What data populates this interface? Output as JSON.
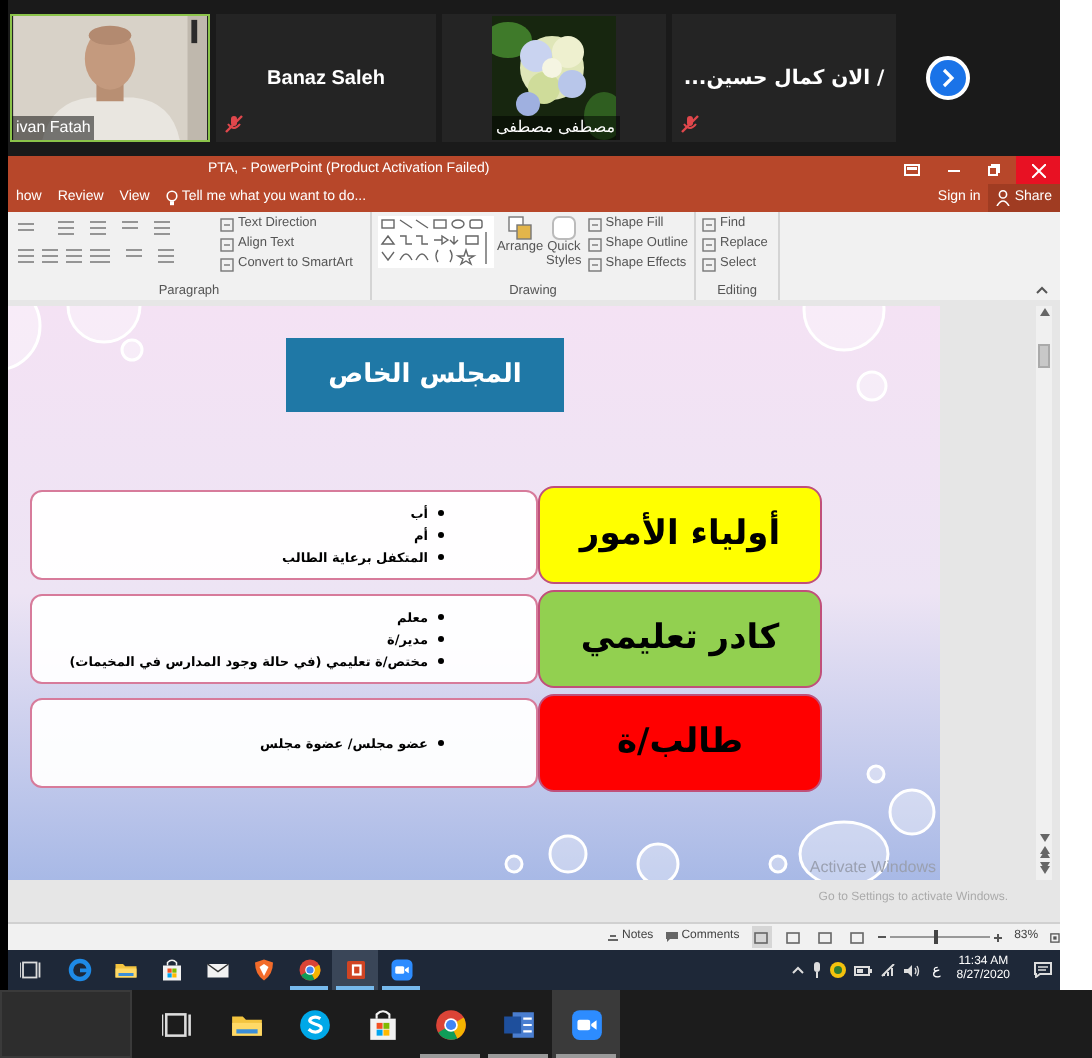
{
  "meeting": {
    "participants": [
      {
        "kind": "video",
        "name": "ivan Fatah",
        "speaking": true,
        "muted": false
      },
      {
        "kind": "name",
        "name": "Banaz Saleh",
        "speaking": false,
        "muted": true
      },
      {
        "name": "مصطفى مصطفى",
        "speaking": false,
        "muted": false
      },
      {
        "kind": "name",
        "name": "...الان كمال حسين /",
        "speaking": false,
        "muted": true
      }
    ]
  },
  "powerpoint": {
    "title": "PTA, - PowerPoint (Product Activation Failed)",
    "tabs": [
      {
        "label": "how",
        "selected": false
      },
      {
        "label": "Review",
        "selected": false
      },
      {
        "label": "View",
        "selected": false
      }
    ],
    "tell_me": "Tell me what you want to do...",
    "sign_in": "Sign in",
    "share": "Share",
    "ribbon": {
      "paragraph": {
        "label": "Paragraph",
        "commands": [
          "Text Direction",
          "Align Text",
          "Convert to SmartArt"
        ]
      },
      "drawing": {
        "label": "Drawing",
        "big_buttons": [
          "Arrange",
          "Quick Styles"
        ],
        "commands": [
          "Shape Fill",
          "Shape Outline",
          "Shape Effects"
        ]
      },
      "editing": {
        "label": "Editing",
        "commands": [
          "Find",
          "Replace",
          "Select"
        ]
      }
    },
    "slide": {
      "title": "المجلس الخاص",
      "rows": [
        {
          "label": "أولياء الأمور",
          "color": "#ffff00",
          "bullets": [
            "أب",
            "أم",
            "المتكفل برعاية الطالب"
          ]
        },
        {
          "label": "كادر تعليمي",
          "color": "#92d050",
          "bullets": [
            "معلم",
            "مدير/ة",
            "مختص/ة تعليمي (في حالة وجود المدارس في المخيمات)"
          ]
        },
        {
          "label": "طالب/ة",
          "color": "#ff0000",
          "bullets": [
            "عضو مجلس/ عضوة مجلس"
          ]
        }
      ]
    },
    "activation": {
      "heading": "Activate Windows",
      "hint": "Go to Settings to activate Windows."
    },
    "status_bar": {
      "notes": "Notes",
      "comments": "Comments",
      "zoom": "83%",
      "zoom_slider": {
        "level": 0.45
      }
    }
  },
  "remote_taskbar": {
    "apps": [
      {
        "kind": "task-view",
        "running": false,
        "selected": false
      },
      {
        "kind": "edge",
        "running": false,
        "selected": false
      },
      {
        "kind": "folder",
        "running": false,
        "selected": false
      },
      {
        "kind": "store",
        "running": false,
        "selected": false
      },
      {
        "kind": "mail",
        "running": false,
        "selected": false
      },
      {
        "kind": "brave",
        "running": false,
        "selected": false
      },
      {
        "kind": "chrome",
        "running": true,
        "selected": false
      },
      {
        "kind": "powerpoint",
        "running": true,
        "selected": true
      },
      {
        "kind": "zoom",
        "running": true,
        "selected": false
      }
    ],
    "input_language": "ع",
    "time": "11:34 AM",
    "date": "8/27/2020"
  },
  "local_taskbar": {
    "apps": [
      {
        "kind": "task-view",
        "running": false,
        "selected": false
      },
      {
        "kind": "folder",
        "running": false,
        "selected": false
      },
      {
        "kind": "skype",
        "running": false,
        "selected": false
      },
      {
        "kind": "store",
        "running": false,
        "selected": false
      },
      {
        "kind": "chrome",
        "running": true,
        "selected": false
      },
      {
        "kind": "word",
        "running": true,
        "selected": false
      },
      {
        "kind": "zoom",
        "running": true,
        "selected": true
      }
    ]
  }
}
